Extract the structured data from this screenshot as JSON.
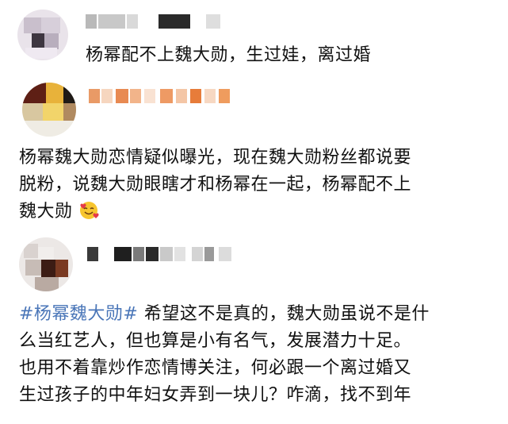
{
  "posts": [
    {
      "text": "杨幂配不上魏大勋，生过娃，离过婚"
    },
    {
      "text_lines": [
        "杨幂魏大勋恋情疑似曝光，现在魏大勋粉丝都说要",
        "脱粉，说魏大勋眼瞎才和杨幂在一起，杨幂配不上",
        "魏大勋"
      ],
      "emoji": "smiling-face-with-hearts-emoji"
    },
    {
      "hashtag": "#杨幂魏大勋#",
      "text_lines": [
        " 希望这不是真的，魏大勋虽说不是什",
        "么当红艺人，但也算是小有名气，发展潜力十足。",
        "也用不着靠炒作恋情博关注，何必跟一个离过婚又",
        "生过孩子的中年妇女弄到一块儿？咋滴，找不到年"
      ]
    }
  ],
  "colors": {
    "hashtag": "#4a76b8",
    "text": "#111111"
  }
}
